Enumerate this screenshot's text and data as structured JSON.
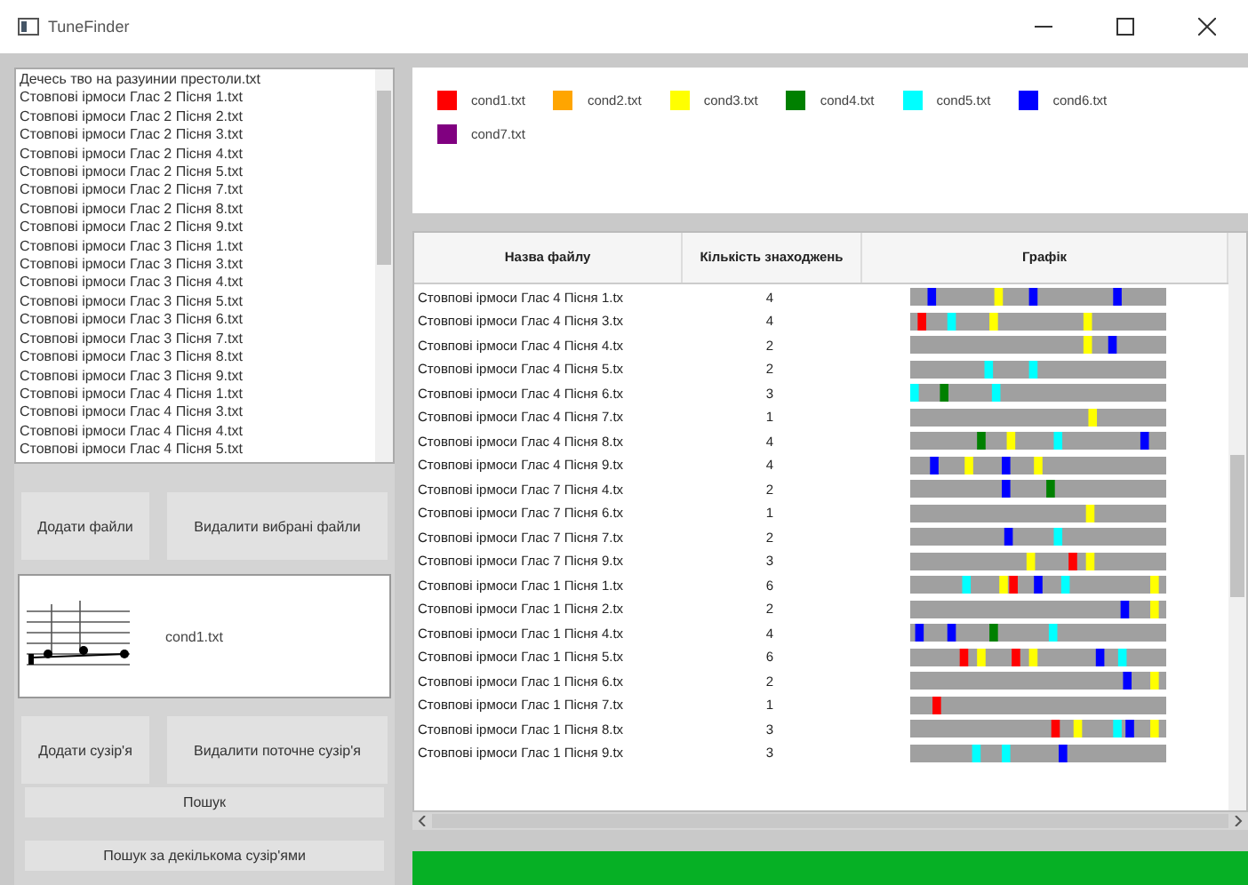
{
  "window": {
    "title": "TuneFinder"
  },
  "files": {
    "items": [
      {
        "label": "Дечесь тво на разуинии престоли.txt",
        "selected": false
      },
      {
        "label": "Стовпові ірмоси Глас 2 Пісня 1.txt",
        "selected": false
      },
      {
        "label": "Стовпові ірмоси Глас 2 Пісня 2.txt",
        "selected": false
      },
      {
        "label": "Стовпові ірмоси Глас 2 Пісня 3.txt",
        "selected": false
      },
      {
        "label": "Стовпові ірмоси Глас 2 Пісня 4.txt",
        "selected": false
      },
      {
        "label": "Стовпові ірмоси Глас 2 Пісня 5.txt",
        "selected": false
      },
      {
        "label": "Стовпові ірмоси Глас 2 Пісня 7.txt",
        "selected": false
      },
      {
        "label": "Стовпові ірмоси Глас 2 Пісня 8.txt",
        "selected": false
      },
      {
        "label": "Стовпові ірмоси Глас 2 Пісня 9.txt",
        "selected": false
      },
      {
        "label": "Стовпові ірмоси Глас 3 Пісня 1.txt",
        "selected": false
      },
      {
        "label": "Стовпові ірмоси Глас 3 Пісня 3.txt",
        "selected": false
      },
      {
        "label": "Стовпові ірмоси Глас 3 Пісня 4.txt",
        "selected": false
      },
      {
        "label": "Стовпові ірмоси Глас 3 Пісня 5.txt",
        "selected": false
      },
      {
        "label": "Стовпові ірмоси Глас 3 Пісня 6.txt",
        "selected": false
      },
      {
        "label": "Стовпові ірмоси Глас 3 Пісня 7.txt",
        "selected": false
      },
      {
        "label": "Стовпові ірмоси Глас 3 Пісня 8.txt",
        "selected": false
      },
      {
        "label": "Стовпові ірмоси Глас 3 Пісня 9.txt",
        "selected": false
      },
      {
        "label": "Стовпові ірмоси Глас 4 Пісня 1.txt",
        "selected": false
      },
      {
        "label": "Стовпові ірмоси Глас 4 Пісня 3.txt",
        "selected": false
      },
      {
        "label": "Стовпові ірмоси Глас 4 Пісня 4.txt",
        "selected": false
      },
      {
        "label": "Стовпові ірмоси Глас 4 Пісня 5.txt",
        "selected": false
      }
    ]
  },
  "file_buttons": [
    "Додати файли",
    "Видалити вибрані файли"
  ],
  "constellation": {
    "name": "cond1.txt"
  },
  "constellation_buttons": [
    "Додати сузір'я",
    "Видалити поточне сузір'я"
  ],
  "search_button": "Пошук",
  "multi_search_button": "Пошук за декількома сузір'ями",
  "legend": [
    {
      "label": "cond1.txt",
      "color": "#ff0000"
    },
    {
      "label": "cond2.txt",
      "color": "#ffa500"
    },
    {
      "label": "cond3.txt",
      "color": "#ffff00"
    },
    {
      "label": "cond4.txt",
      "color": "#008000"
    },
    {
      "label": "cond5.txt",
      "color": "#00ffff"
    },
    {
      "label": "cond6.txt",
      "color": "#0000ff"
    },
    {
      "label": "cond7.txt",
      "color": "#800080"
    }
  ],
  "table": {
    "columns": [
      "Назва файлу",
      "Кількість знаходжень",
      "Графік"
    ],
    "rows": [
      [
        "Стовпові ірмоси Глас 4 Пісня 1.tx",
        "4"
      ],
      [
        "Стовпові ірмоси Глас 4 Пісня 3.tx",
        "4"
      ],
      [
        "Стовпові ірмоси Глас 4 Пісня 4.tx",
        "2"
      ],
      [
        "Стовпові ірмоси Глас 4 Пісня 5.tx",
        "2"
      ],
      [
        "Стовпові ірмоси Глас 4 Пісня 6.tx",
        "3"
      ],
      [
        "Стовпові ірмоси Глас 4 Пісня 7.tx",
        "1"
      ],
      [
        "Стовпові ірмоси Глас 4 Пісня 8.tx",
        "4"
      ],
      [
        "Стовпові ірмоси Глас 4 Пісня 9.tx",
        "4"
      ],
      [
        "Стовпові ірмоси Глас 7 Пісня 4.tx",
        "2"
      ],
      [
        "Стовпові ірмоси Глас 7 Пісня 6.tx",
        "1"
      ],
      [
        "Стовпові ірмоси Глас 7 Пісня 7.tx",
        "2"
      ],
      [
        "Стовпові ірмоси Глас 7 Пісня 9.tx",
        "3"
      ],
      [
        "Стовпові ірмоси Глас 1 Пісня 1.tx",
        "6"
      ],
      [
        "Стовпові ірмоси Глас 1 Пісня 2.tx",
        "2"
      ],
      [
        "Стовпові ірмоси Глас 1 Пісня 4.tx",
        "4"
      ],
      [
        "Стовпові ірмоси Глас 1 Пісня 5.tx",
        "6"
      ],
      [
        "Стовпові ірмоси Глас 1 Пісня 6.tx",
        "2"
      ],
      [
        "Стовпові ірмоси Глас 1 Пісня 7.tx",
        "1"
      ],
      [
        "Стовпові ірмоси Глас 1 Пісня 8.tx",
        "3"
      ],
      [
        "Стовпові ірмоси Глас 1 Пісня 9.tx",
        "3"
      ]
    ]
  },
  "progress": {
    "level": 1
  }
}
